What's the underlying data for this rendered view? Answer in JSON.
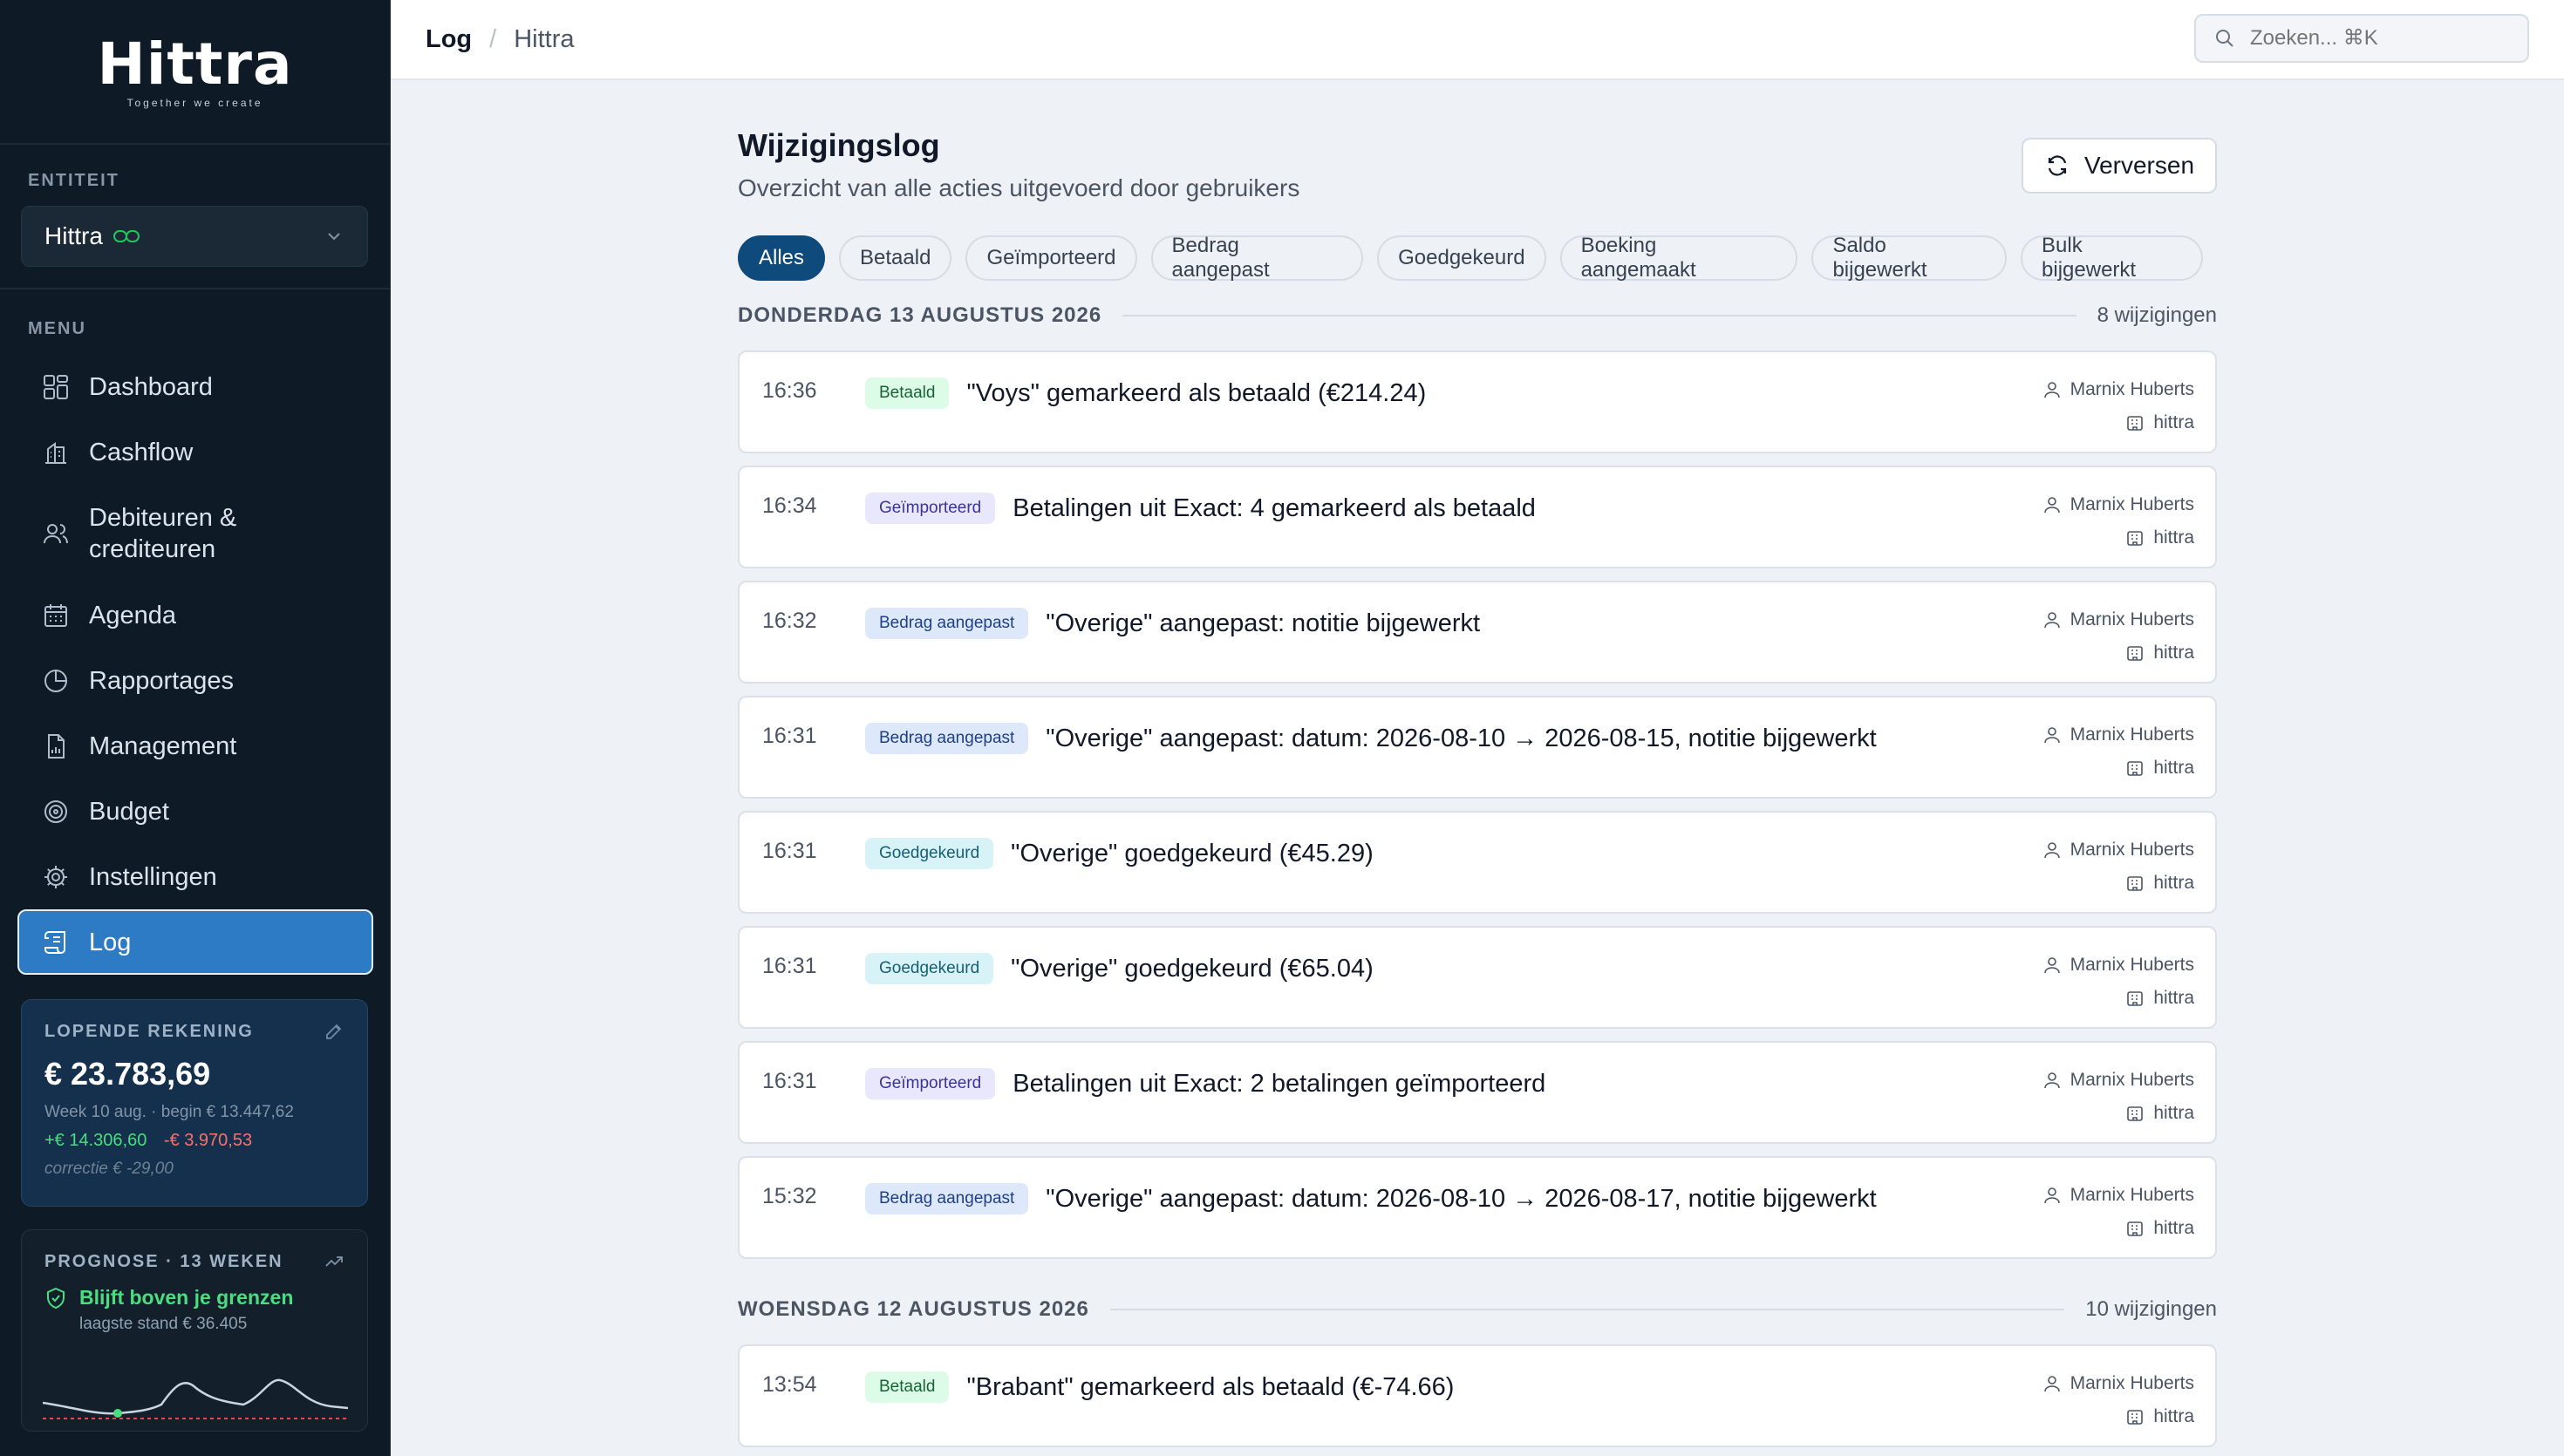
{
  "brand": {
    "name": "Hittra",
    "tagline": "Together we create"
  },
  "sidebar": {
    "entity_label": "ENTITEIT",
    "entity_value": "Hittra",
    "menu_label": "MENU",
    "items": [
      {
        "label": "Dashboard",
        "icon": "dashboard-icon"
      },
      {
        "label": "Cashflow",
        "icon": "cashflow-icon"
      },
      {
        "label": "Debiteuren & crediteuren",
        "icon": "users-icon"
      },
      {
        "label": "Agenda",
        "icon": "calendar-icon"
      },
      {
        "label": "Rapportages",
        "icon": "pie-chart-icon"
      },
      {
        "label": "Management",
        "icon": "report-icon"
      },
      {
        "label": "Budget",
        "icon": "target-icon"
      },
      {
        "label": "Instellingen",
        "icon": "gear-icon"
      },
      {
        "label": "Log",
        "icon": "log-icon",
        "active": true
      }
    ],
    "account": {
      "title": "LOPENDE REKENING",
      "amount": "€ 23.783,69",
      "week": "Week 10 aug. · begin € 13.447,62",
      "plus": "+€ 14.306,60",
      "minus": "-€ 3.970,53",
      "correction": "correctie € -29,00"
    },
    "forecast": {
      "title": "PROGNOSE · 13 WEKEN",
      "status": "Blijft boven je grenzen",
      "lowest": "laagste stand € 36.405"
    }
  },
  "topbar": {
    "crumb_current": "Log",
    "crumb_separator": "/",
    "crumb_entity": "Hittra",
    "search_placeholder": "Zoeken... ⌘K"
  },
  "page": {
    "title": "Wijzigingslog",
    "subtitle": "Overzicht van alle acties uitgevoerd door gebruikers",
    "refresh_label": "Verversen"
  },
  "filters": [
    "Alles",
    "Betaald",
    "Geïmporteerd",
    "Bedrag aangepast",
    "Goedgekeurd",
    "Boeking aangemaakt",
    "Saldo bijgewerkt",
    "Bulk bijgewerkt"
  ],
  "days": [
    {
      "label": "DONDERDAG 13 AUGUSTUS 2026",
      "count": "8 wijzigingen",
      "entries": [
        {
          "time": "16:36",
          "badge": "Betaald",
          "type": "betaald",
          "text": "\"Voys\" gemarkeerd als betaald (€214.24)",
          "user": "Marnix Huberts",
          "entity": "hittra"
        },
        {
          "time": "16:34",
          "badge": "Geïmporteerd",
          "type": "geimporteerd",
          "text": "Betalingen uit Exact: 4 gemarkeerd als betaald",
          "user": "Marnix Huberts",
          "entity": "hittra"
        },
        {
          "time": "16:32",
          "badge": "Bedrag aangepast",
          "type": "bedrag",
          "text": "\"Overige\" aangepast: notitie bijgewerkt",
          "user": "Marnix Huberts",
          "entity": "hittra"
        },
        {
          "time": "16:31",
          "badge": "Bedrag aangepast",
          "type": "bedrag",
          "text": "\"Overige\" aangepast: datum: 2026-08-10 → 2026-08-15, notitie bijgewerkt",
          "user": "Marnix Huberts",
          "entity": "hittra"
        },
        {
          "time": "16:31",
          "badge": "Goedgekeurd",
          "type": "goedgekeurd",
          "text": "\"Overige\" goedgekeurd (€45.29)",
          "user": "Marnix Huberts",
          "entity": "hittra"
        },
        {
          "time": "16:31",
          "badge": "Goedgekeurd",
          "type": "goedgekeurd",
          "text": "\"Overige\" goedgekeurd (€65.04)",
          "user": "Marnix Huberts",
          "entity": "hittra"
        },
        {
          "time": "16:31",
          "badge": "Geïmporteerd",
          "type": "geimporteerd",
          "text": "Betalingen uit Exact: 2 betalingen geïmporteerd",
          "user": "Marnix Huberts",
          "entity": "hittra"
        },
        {
          "time": "15:32",
          "badge": "Bedrag aangepast",
          "type": "bedrag",
          "text": "\"Overige\" aangepast: datum: 2026-08-10 → 2026-08-17, notitie bijgewerkt",
          "user": "Marnix Huberts",
          "entity": "hittra"
        }
      ]
    },
    {
      "label": "WOENSDAG 12 AUGUSTUS 2026",
      "count": "10 wijzigingen",
      "entries": [
        {
          "time": "13:54",
          "badge": "Betaald",
          "type": "betaald",
          "text": "\"Brabant\" gemarkeerd als betaald (€-74.66)",
          "user": "Marnix Huberts",
          "entity": "hittra"
        }
      ]
    }
  ],
  "colors": {
    "accent": "#2d7bc4",
    "sidebar_bg": "#0e1a26",
    "filter_active": "#0f4a7c",
    "positive": "#4ade80",
    "negative": "#f87171"
  }
}
